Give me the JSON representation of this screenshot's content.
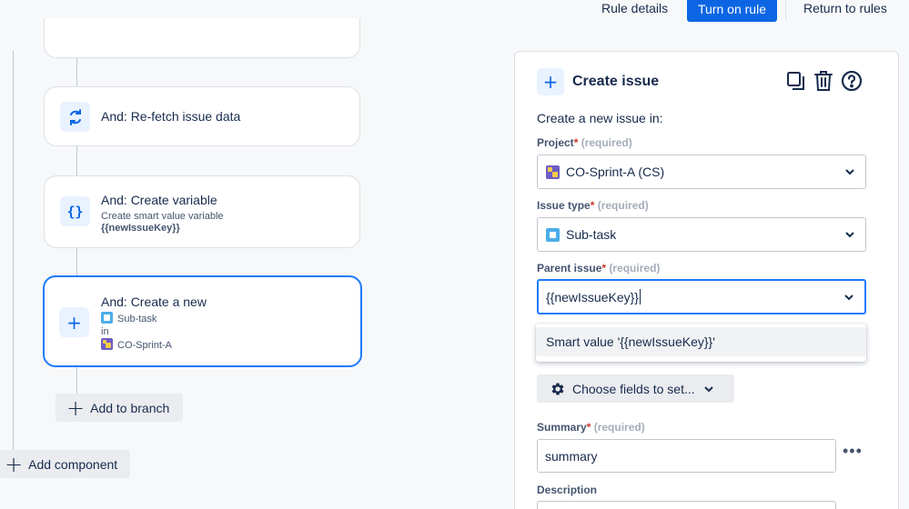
{
  "header": {
    "rule_details": "Rule details",
    "turn_on_rule": "Turn on rule",
    "return_to_rules": "Return to rules"
  },
  "canvas": {
    "refetch_card": {
      "title": "And: Re-fetch issue data",
      "icon": "refresh-icon"
    },
    "variable_card": {
      "title": "And: Create variable",
      "subtitle": "Create smart value variable",
      "variable": "{{newIssueKey}}",
      "icon": "curly-braces-icon"
    },
    "create_card": {
      "title": "And: Create a new",
      "issue_type": "Sub-task",
      "in_label": "in",
      "project": "CO-Sprint-A",
      "icon": "plus-icon"
    },
    "add_to_branch": "Add to branch",
    "add_component": "Add component"
  },
  "panel": {
    "title": "Create issue",
    "intro": "Create a new issue in:",
    "project": {
      "label": "Project",
      "required": "(required)",
      "value": "CO-Sprint-A (CS)"
    },
    "issue_type": {
      "label": "Issue type",
      "required": "(required)",
      "value": "Sub-task"
    },
    "parent_issue": {
      "label": "Parent issue",
      "required": "(required)",
      "value": "{{newIssueKey}}",
      "suggestion": "Smart value '{{newIssueKey}}'"
    },
    "choose_fields": "Choose fields to set...",
    "summary": {
      "label": "Summary",
      "required": "(required)",
      "value": "summary"
    },
    "description": {
      "label": "Description"
    }
  },
  "colors": {
    "primary": "#0c66e4",
    "selected_border": "#1d7afc",
    "required": "#c9372c",
    "subtask_icon": "#4bade8",
    "project_icon": "#6e5dc6"
  }
}
